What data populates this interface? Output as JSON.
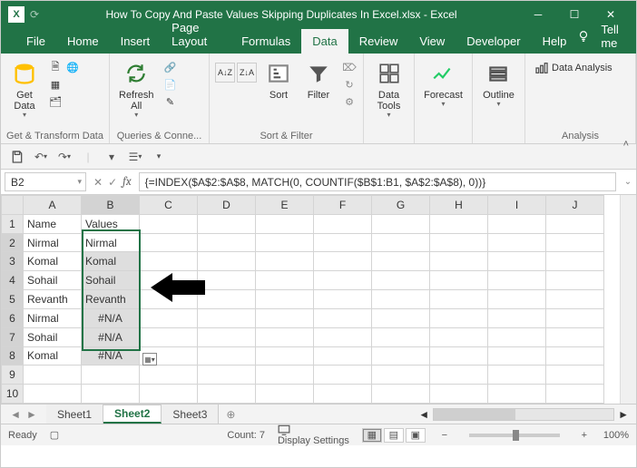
{
  "title": "How To Copy And Paste Values Skipping Duplicates In Excel.xlsx  -  Excel",
  "menu": {
    "tabs": [
      "File",
      "Home",
      "Insert",
      "Page Layout",
      "Formulas",
      "Data",
      "Review",
      "View",
      "Developer",
      "Help"
    ],
    "active": "Data",
    "tellme": "Tell me"
  },
  "ribbon": {
    "getdata": "Get\nData",
    "refresh": "Refresh\nAll",
    "sort": "Sort",
    "filter": "Filter",
    "datatools": "Data\nTools",
    "forecast": "Forecast",
    "outline": "Outline",
    "analysis": "Data Analysis",
    "g1": "Get & Transform Data",
    "g2": "Queries & Conne...",
    "g3": "Sort & Filter",
    "g4": "Analysis"
  },
  "namebox": "B2",
  "formula": "{=INDEX($A$2:$A$8, MATCH(0, COUNTIF($B$1:B1, $A$2:$A$8), 0))}",
  "columns": [
    "A",
    "B",
    "C",
    "D",
    "E",
    "F",
    "G",
    "H",
    "I",
    "J"
  ],
  "rows": [
    {
      "n": 1,
      "a": "Name",
      "b": "Values"
    },
    {
      "n": 2,
      "a": "Nirmal",
      "b": "Nirmal"
    },
    {
      "n": 3,
      "a": "Komal",
      "b": "Komal"
    },
    {
      "n": 4,
      "a": "Sohail",
      "b": "Sohail"
    },
    {
      "n": 5,
      "a": "Revanth",
      "b": "Revanth"
    },
    {
      "n": 6,
      "a": "Nirmal",
      "b": "#N/A"
    },
    {
      "n": 7,
      "a": "Sohail",
      "b": "#N/A"
    },
    {
      "n": 8,
      "a": "Komal",
      "b": "#N/A"
    },
    {
      "n": 9,
      "a": "",
      "b": ""
    },
    {
      "n": 10,
      "a": "",
      "b": ""
    }
  ],
  "selection": {
    "col": "B",
    "startRow": 2,
    "endRow": 8
  },
  "sheets": {
    "items": [
      "Sheet1",
      "Sheet2",
      "Sheet3"
    ],
    "active": "Sheet2"
  },
  "status": {
    "ready": "Ready",
    "count_label": "Count:",
    "count": 7,
    "display": "Display Settings",
    "zoom": "100%"
  }
}
